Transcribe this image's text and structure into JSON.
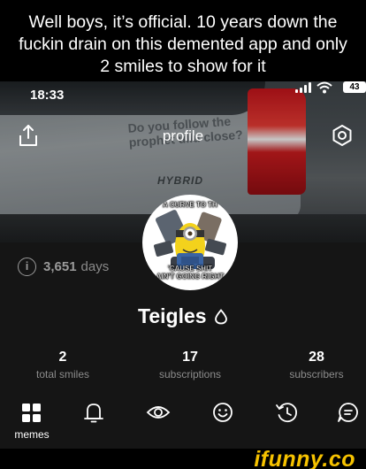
{
  "caption": {
    "line1": "Well boys, it’s official. 10 years down the",
    "line2": "fuckin drain on this demented app and only",
    "line3": "2 smiles to show for it"
  },
  "status_bar": {
    "time": "18:33",
    "battery": "43"
  },
  "header": {
    "title": "profile",
    "share_icon": "share-icon",
    "settings_icon": "settings-icon"
  },
  "cover": {
    "sticker_line1": "Do you follow the",
    "sticker_line2": "prophet ullu close?",
    "badge": "HYBRID"
  },
  "avatar": {
    "caption_top": "A CURVE TO TH",
    "caption_bottom_1": "'CAUSE SHIT",
    "caption_bottom_2": "AIN'T GOING RIGHT"
  },
  "account": {
    "days_value": "3,651",
    "days_label": "days",
    "username": "Teigles"
  },
  "stats": [
    {
      "value": "2",
      "label": "total smiles"
    },
    {
      "value": "17",
      "label": "subscriptions"
    },
    {
      "value": "28",
      "label": "subscribers"
    }
  ],
  "tabs": [
    {
      "icon": "grid-icon",
      "label": "memes"
    },
    {
      "icon": "bell-icon",
      "label": ""
    },
    {
      "icon": "eye-icon",
      "label": ""
    },
    {
      "icon": "smile-icon",
      "label": ""
    },
    {
      "icon": "history-icon",
      "label": ""
    },
    {
      "icon": "chat-icon",
      "label": ""
    }
  ],
  "watermark": "ifunny.co",
  "colors": {
    "background": "#151515",
    "accent": "#f6c200",
    "muted_text": "#8c8c8c"
  }
}
